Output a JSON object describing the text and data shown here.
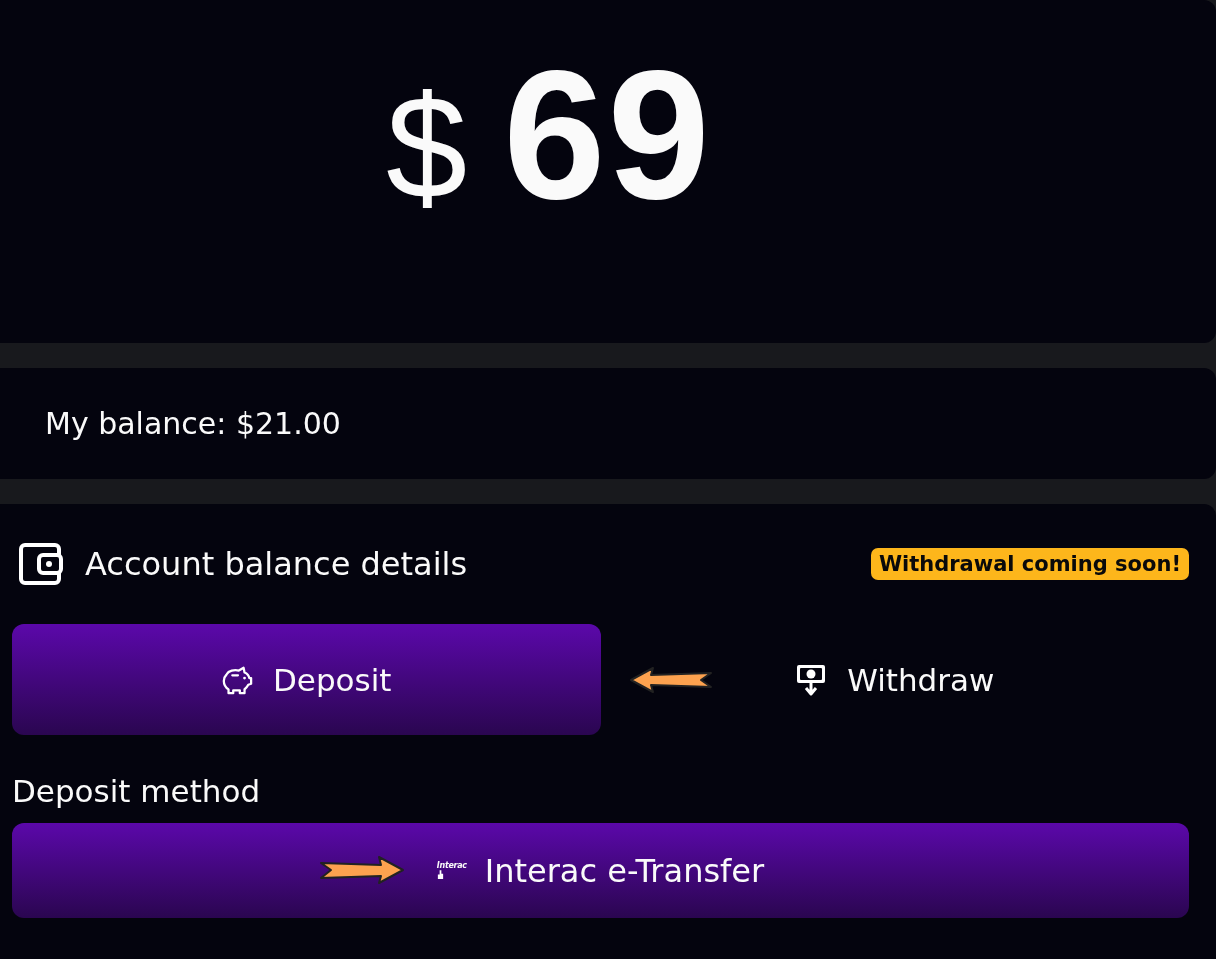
{
  "amount": {
    "currency": "$",
    "value": "69"
  },
  "balance": {
    "text": "My balance: $21.00"
  },
  "account": {
    "title": "Account balance details",
    "badge": "Withdrawal coming soon!"
  },
  "tabs": [
    {
      "label": "Deposit",
      "selected": true
    },
    {
      "label": "Withdraw",
      "selected": false
    }
  ],
  "deposit_method": {
    "label": "Deposit method",
    "logo_text": "Interac",
    "button": "Interac e-Transfer"
  }
}
